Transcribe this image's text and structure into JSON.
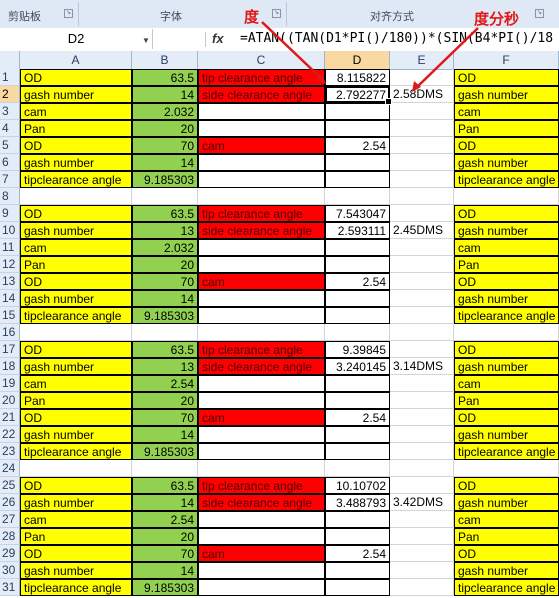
{
  "ribbon": {
    "clipboard": "剪贴板",
    "font": "字体",
    "alignment": "对齐方式",
    "launcher_glyph": "↘"
  },
  "annotations": {
    "degree": "度",
    "dms": "度分秒",
    "color": "#e01818"
  },
  "formula_bar": {
    "name_box": "D2",
    "fx": "fx",
    "formula": "=ATAN((TAN(D1*PI()/180))*(SIN(B4*PI()/18"
  },
  "columns": [
    "A",
    "B",
    "C",
    "D",
    "E",
    "F"
  ],
  "selected_column": "D",
  "selected_row": 2,
  "colors": {
    "yellow": "#ffff00",
    "green": "#92d050",
    "red": "#ff0000",
    "header": "#e4ecf7",
    "selected_header": "#f9d99f"
  },
  "rows": [
    {
      "n": "1",
      "a": "OD",
      "b": "63.5",
      "c": "tip clearance angle",
      "d": "8.115822",
      "e": "",
      "f": "OD"
    },
    {
      "n": "2",
      "a": "gash number",
      "b": "14",
      "c": "side clearance angle",
      "d": "2.792277",
      "e": "2.58DMS",
      "f": "gash number"
    },
    {
      "n": "3",
      "a": "cam",
      "b": "2.032",
      "c": "",
      "d": "",
      "e": "",
      "f": "cam"
    },
    {
      "n": "4",
      "a": "Pan",
      "b": "20",
      "c": "",
      "d": "",
      "e": "",
      "f": "Pan"
    },
    {
      "n": "5",
      "a": "OD",
      "b": "70",
      "c": "cam",
      "d": "2.54",
      "e": "",
      "f": "OD"
    },
    {
      "n": "6",
      "a": "gash number",
      "b": "14",
      "c": "",
      "d": "",
      "e": "",
      "f": "gash number"
    },
    {
      "n": "7",
      "a": "tipclearance angle",
      "b": "9.185303",
      "c": "",
      "d": "",
      "e": "",
      "f": "tipclearance angle"
    },
    {
      "n": "8",
      "a": "",
      "b": "",
      "c": "",
      "d": "",
      "e": "",
      "f": ""
    },
    {
      "n": "9",
      "a": "OD",
      "b": "63.5",
      "c": "tip clearance angle",
      "d": "7.543047",
      "e": "",
      "f": "OD"
    },
    {
      "n": "10",
      "a": "gash number",
      "b": "13",
      "c": "side clearance angle",
      "d": "2.593111",
      "e": "2.45DMS",
      "f": "gash number"
    },
    {
      "n": "11",
      "a": "cam",
      "b": "2.032",
      "c": "",
      "d": "",
      "e": "",
      "f": "cam"
    },
    {
      "n": "12",
      "a": "Pan",
      "b": "20",
      "c": "",
      "d": "",
      "e": "",
      "f": "Pan"
    },
    {
      "n": "13",
      "a": "OD",
      "b": "70",
      "c": "cam",
      "d": "2.54",
      "e": "",
      "f": "OD"
    },
    {
      "n": "14",
      "a": "gash number",
      "b": "14",
      "c": "",
      "d": "",
      "e": "",
      "f": "gash number"
    },
    {
      "n": "15",
      "a": "tipclearance angle",
      "b": "9.185303",
      "c": "",
      "d": "",
      "e": "",
      "f": "tipclearance angle"
    },
    {
      "n": "16",
      "a": "",
      "b": "",
      "c": "",
      "d": "",
      "e": "",
      "f": ""
    },
    {
      "n": "17",
      "a": "OD",
      "b": "63.5",
      "c": "tip clearance angle",
      "d": "9.39845",
      "e": "",
      "f": "OD"
    },
    {
      "n": "18",
      "a": "gash number",
      "b": "13",
      "c": "side clearance angle",
      "d": "3.240145",
      "e": "3.14DMS",
      "f": "gash number"
    },
    {
      "n": "19",
      "a": "cam",
      "b": "2.54",
      "c": "",
      "d": "",
      "e": "",
      "f": "cam"
    },
    {
      "n": "20",
      "a": "Pan",
      "b": "20",
      "c": "",
      "d": "",
      "e": "",
      "f": "Pan"
    },
    {
      "n": "21",
      "a": "OD",
      "b": "70",
      "c": "cam",
      "d": "2.54",
      "e": "",
      "f": "OD"
    },
    {
      "n": "22",
      "a": "gash number",
      "b": "14",
      "c": "",
      "d": "",
      "e": "",
      "f": "gash number"
    },
    {
      "n": "23",
      "a": "tipclearance angle",
      "b": "9.185303",
      "c": "",
      "d": "",
      "e": "",
      "f": "tipclearance angle"
    },
    {
      "n": "24",
      "a": "",
      "b": "",
      "c": "",
      "d": "",
      "e": "",
      "f": ""
    },
    {
      "n": "25",
      "a": "OD",
      "b": "63.5",
      "c": "tip clearance angle",
      "d": "10.10702",
      "e": "",
      "f": "OD"
    },
    {
      "n": "26",
      "a": "gash number",
      "b": "14",
      "c": "side clearance angle",
      "d": "3.488793",
      "e": "3.42DMS",
      "f": "gash number"
    },
    {
      "n": "27",
      "a": "cam",
      "b": "2.54",
      "c": "",
      "d": "",
      "e": "",
      "f": "cam"
    },
    {
      "n": "28",
      "a": "Pan",
      "b": "20",
      "c": "",
      "d": "",
      "e": "",
      "f": "Pan"
    },
    {
      "n": "29",
      "a": "OD",
      "b": "70",
      "c": "cam",
      "d": "2.54",
      "e": "",
      "f": "OD"
    },
    {
      "n": "30",
      "a": "gash number",
      "b": "14",
      "c": "",
      "d": "",
      "e": "",
      "f": "gash number"
    },
    {
      "n": "31",
      "a": "tipclearance angle",
      "b": "9.185303",
      "c": "",
      "d": "",
      "e": "",
      "f": "tipclearance angle"
    }
  ]
}
